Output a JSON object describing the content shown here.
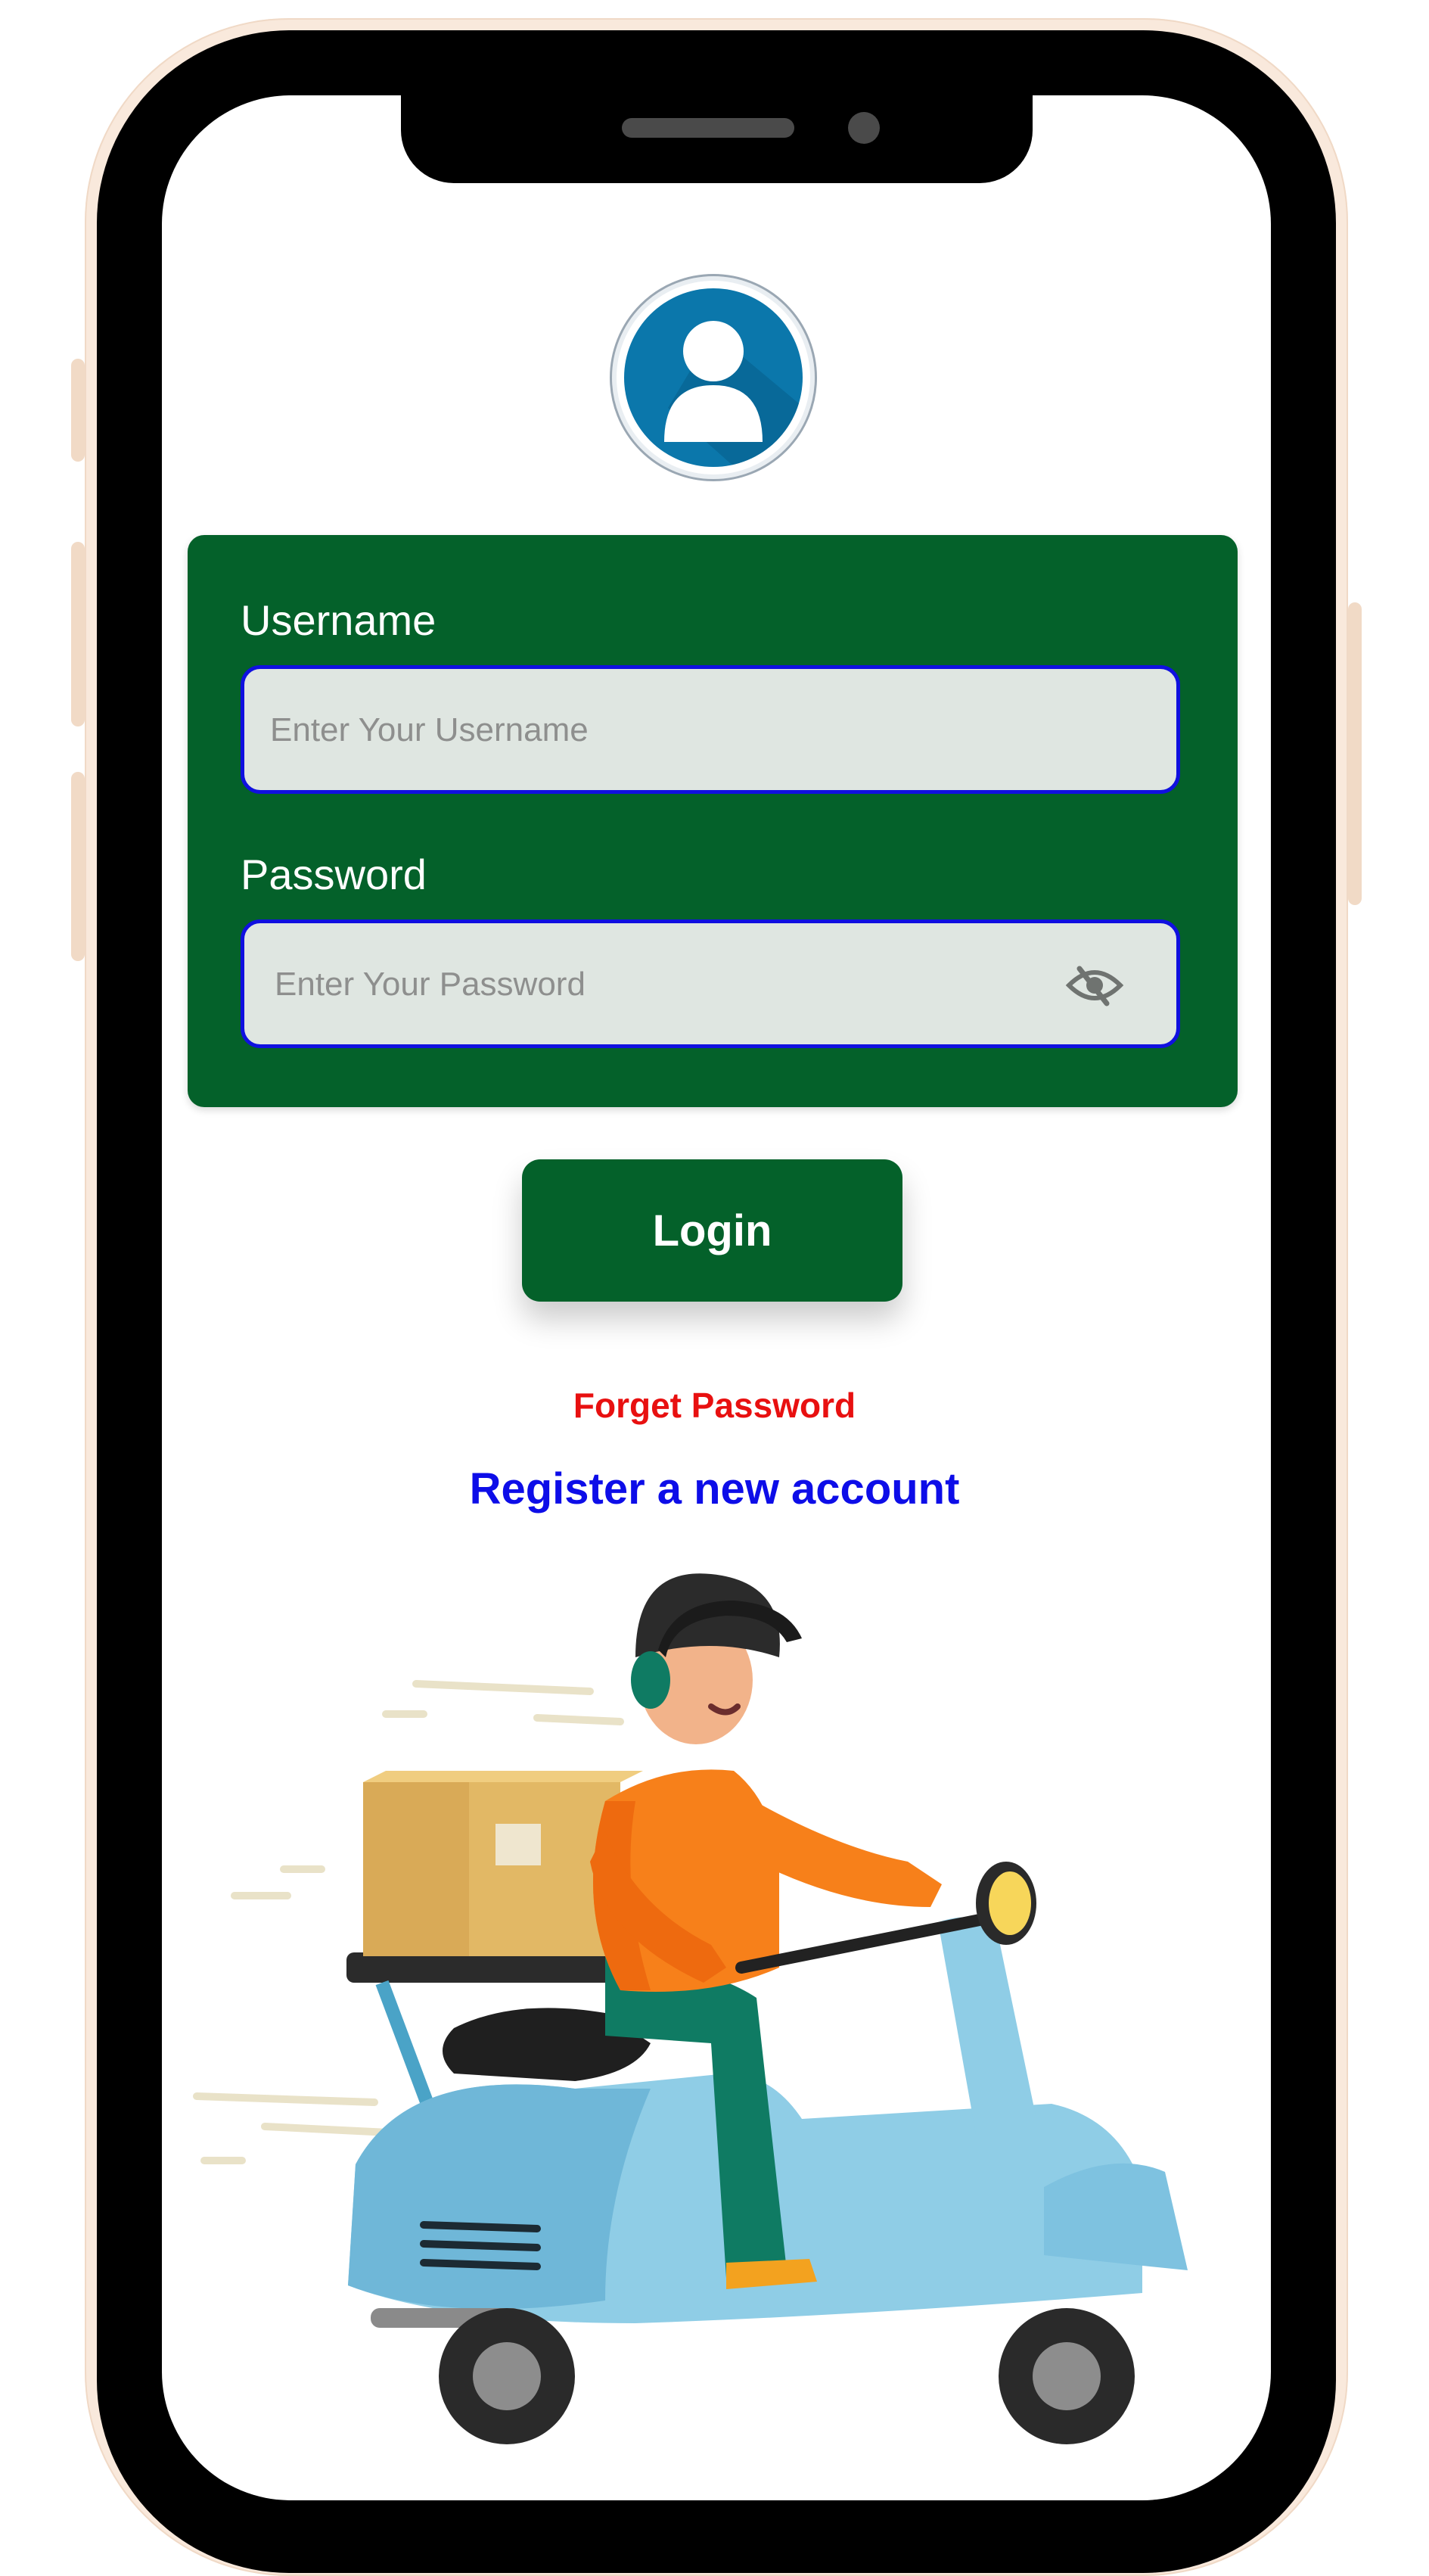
{
  "login_form": {
    "username_label": "Username",
    "username_placeholder": "Enter Your Username",
    "password_label": "Password",
    "password_placeholder": "Enter Your Password"
  },
  "actions": {
    "login_label": "Login",
    "forget_password_label": "Forget Password",
    "register_label": "Register a new account"
  },
  "icons": {
    "avatar": "user-avatar-icon",
    "password_toggle": "eye-slash-icon",
    "illustration": "delivery-scooter-illustration"
  },
  "colors": {
    "primary_green": "#04612a",
    "input_bg": "#dfe6e1",
    "input_border": "#1010e0",
    "forget_link": "#e81010",
    "register_link": "#0d0de8"
  }
}
